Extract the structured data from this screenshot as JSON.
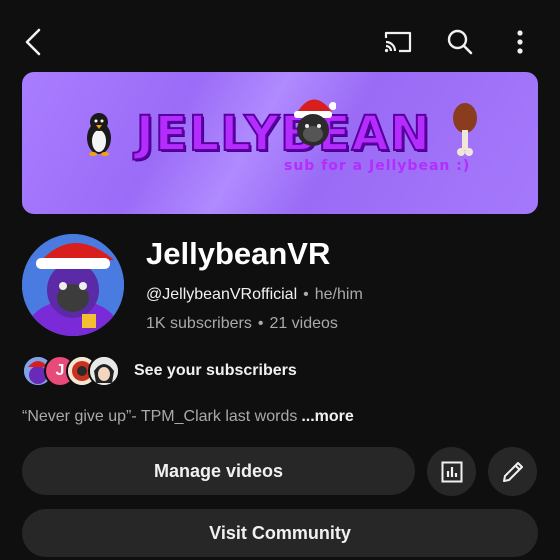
{
  "banner": {
    "title": "JELLYBEAN",
    "subtitle": "sub for a Jellybean :)"
  },
  "channel": {
    "name": "JellybeanVR",
    "handle": "@JellybeanVRofficial",
    "pronouns": "he/him",
    "subscribers": "1K subscribers",
    "videos": "21 videos",
    "separator": "•"
  },
  "subscribers_preview": {
    "initial": "J",
    "label": "See your subscribers"
  },
  "description": {
    "text": "“Never give up”- TPM_Clark last words",
    "more_label": "...more"
  },
  "actions": {
    "manage_videos": "Manage videos",
    "visit_community": "Visit Community"
  },
  "icons": {
    "back": "back-arrow-icon",
    "cast": "cast-icon",
    "search": "search-icon",
    "more": "more-vertical-icon",
    "analytics": "analytics-icon",
    "edit": "pencil-icon"
  },
  "colors": {
    "background": "#0f0f0f",
    "button_bg": "#272727",
    "banner_purple": "#a97dff",
    "banner_text": "#b52cff",
    "secondary_text": "#aaaaaa"
  }
}
